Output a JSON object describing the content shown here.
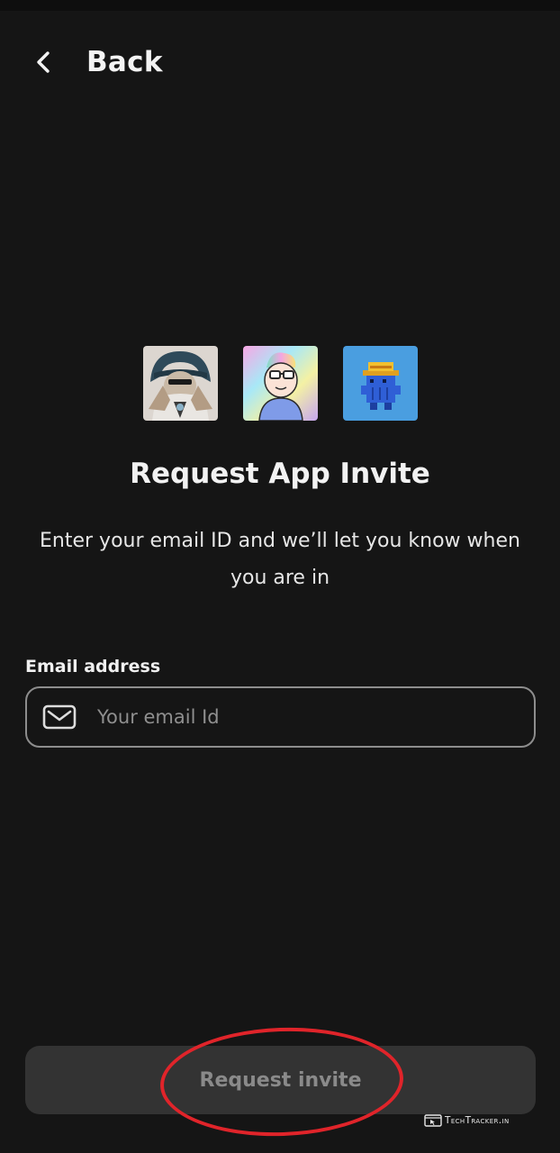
{
  "header": {
    "back_label": "Back",
    "back_icon": "chevron-left-icon"
  },
  "avatars": [
    {
      "name": "hooded-figure-avatar",
      "bg": "#d9d4cf"
    },
    {
      "name": "rainbow-hair-avatar",
      "bg": "#d8b8ef"
    },
    {
      "name": "pixel-creature-avatar",
      "bg": "#4a9ee0"
    }
  ],
  "main": {
    "title": "Request App Invite",
    "subtitle": "Enter your email ID and we’ll let you know when you are in"
  },
  "form": {
    "email_label": "Email address",
    "email_placeholder": "Your email Id",
    "email_value": "",
    "mail_icon": "mail-icon"
  },
  "footer": {
    "request_button_label": "Request invite"
  },
  "watermark": {
    "text": "TechTracker.in"
  },
  "colors": {
    "background": "#151515",
    "button_bg": "#333333",
    "button_text": "#8a8a8a",
    "annotation_ring": "#e0242a"
  }
}
